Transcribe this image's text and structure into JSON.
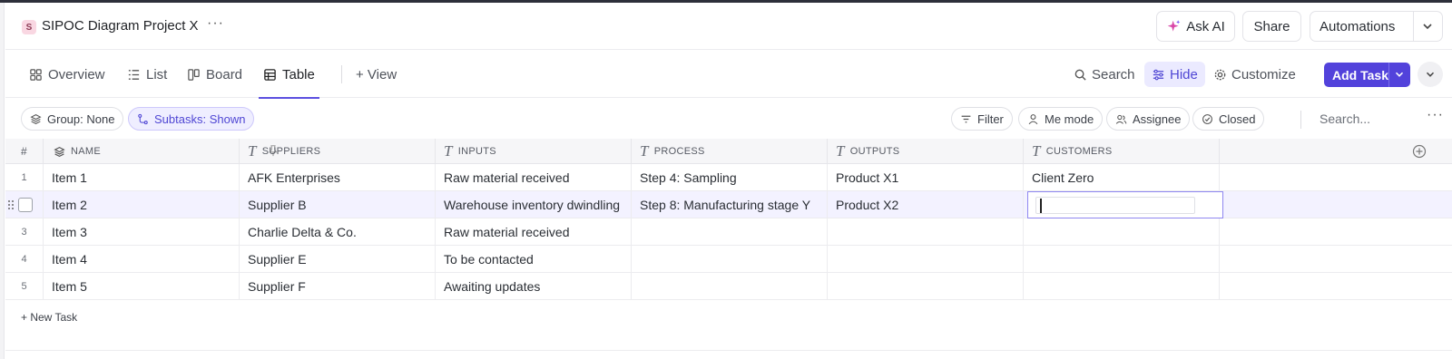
{
  "project": {
    "badge": "S",
    "title": "SIPOC Diagram Project X",
    "more": "···"
  },
  "header": {
    "ask_ai": "Ask AI",
    "share": "Share",
    "automations": "Automations"
  },
  "views": {
    "tabs": [
      {
        "label": "Overview",
        "icon": "overview-icon"
      },
      {
        "label": "List",
        "icon": "list-icon"
      },
      {
        "label": "Board",
        "icon": "board-icon"
      },
      {
        "label": "Table",
        "icon": "table-icon",
        "active": true
      }
    ],
    "add_view": "+ View",
    "search": "Search",
    "hide": "Hide",
    "customize": "Customize",
    "add_task": "Add Task"
  },
  "filters": {
    "group": "Group: None",
    "subtasks": "Subtasks: Shown",
    "filter": "Filter",
    "me_mode": "Me mode",
    "assignee": "Assignee",
    "closed": "Closed",
    "search_placeholder": "Search...",
    "more": "···"
  },
  "table": {
    "columns": {
      "hash": "#",
      "name": "NAME",
      "suppliers": "SUPPLIERS",
      "inputs": "INPUTS",
      "process": "PROCESS",
      "outputs": "OUTPUTS",
      "customers": "CUSTOMERS"
    },
    "rows": [
      {
        "index": "1",
        "name": "Item 1",
        "suppliers": "AFK Enterprises",
        "inputs": "Raw material received",
        "process": "Step 4: Sampling",
        "outputs": "Product X1",
        "customers": "Client Zero"
      },
      {
        "index": "",
        "name": "Item 2",
        "suppliers": "Supplier B",
        "inputs": "Warehouse inventory dwindling",
        "process": "Step 8: Manufacturing stage Y",
        "outputs": "Product X2",
        "customers": ""
      },
      {
        "index": "3",
        "name": "Item 3",
        "suppliers": "Charlie Delta & Co.",
        "inputs": "Raw material received",
        "process": "",
        "outputs": "",
        "customers": ""
      },
      {
        "index": "4",
        "name": "Item 4",
        "suppliers": "Supplier E",
        "inputs": "To be contacted",
        "process": "",
        "outputs": "",
        "customers": ""
      },
      {
        "index": "5",
        "name": "Item 5",
        "suppliers": "Supplier F",
        "inputs": "Awaiting updates",
        "process": "",
        "outputs": "",
        "customers": ""
      }
    ],
    "new_task": "+ New Task"
  },
  "colors": {
    "accent": "#5242db",
    "accent_light": "#efeeff",
    "selected_row": "#f3f2ff"
  }
}
